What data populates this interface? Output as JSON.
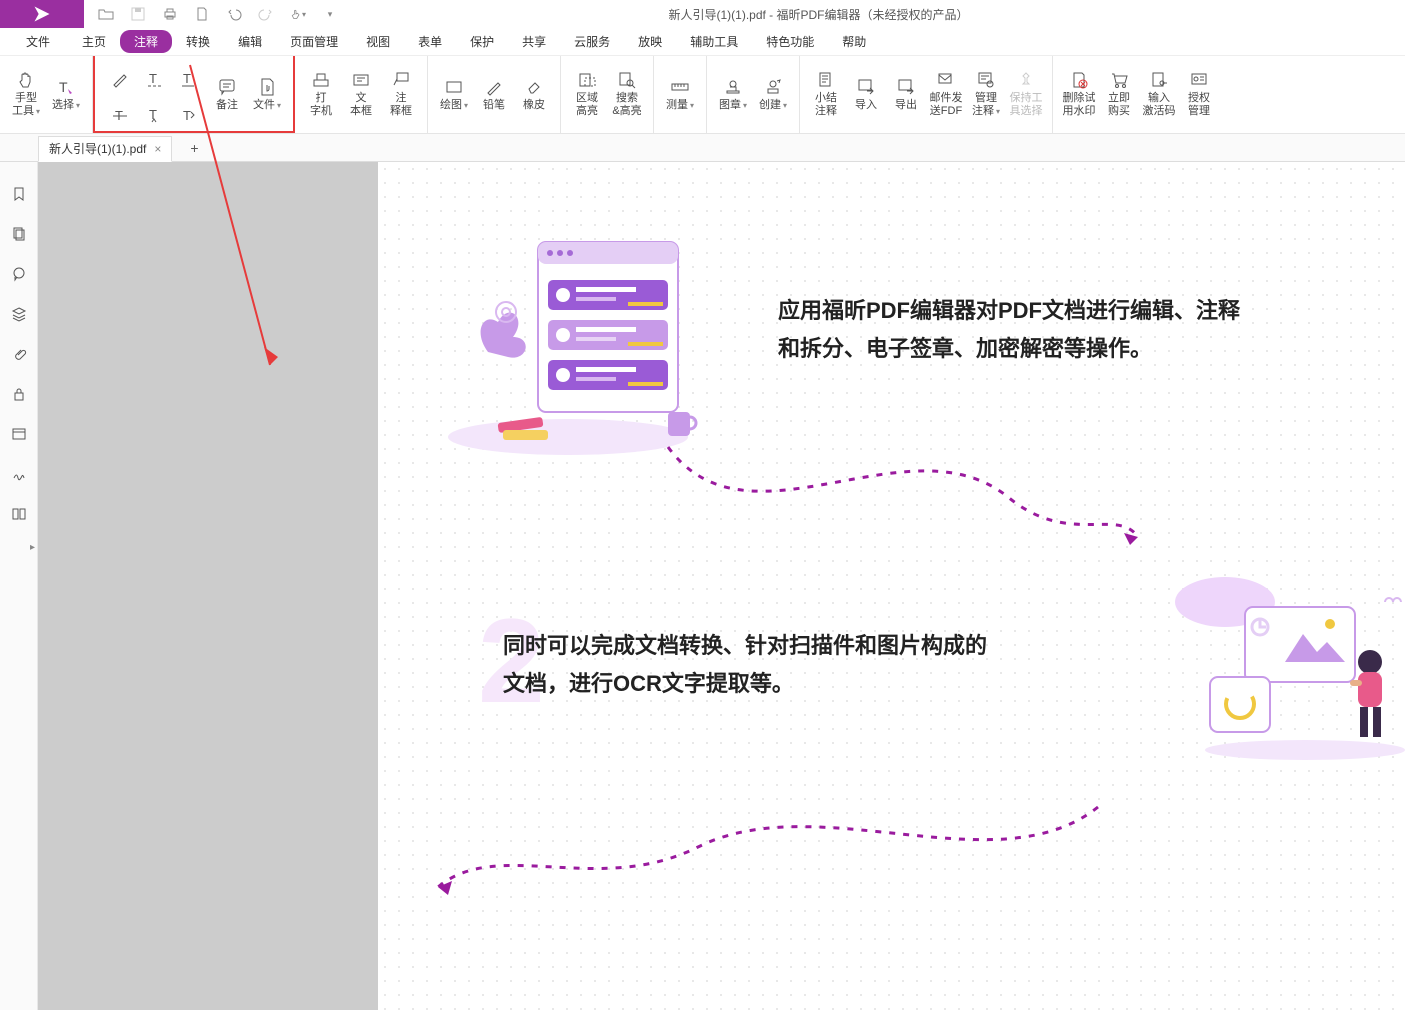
{
  "app_title": "新人引导(1)(1).pdf - 福昕PDF编辑器（未经授权的产品）",
  "menu": {
    "file": "文件",
    "items": [
      "主页",
      "注释",
      "转换",
      "编辑",
      "页面管理",
      "视图",
      "表单",
      "保护",
      "共享",
      "云服务",
      "放映",
      "辅助工具",
      "特色功能",
      "帮助"
    ],
    "active_index": 1
  },
  "ribbon": {
    "hand": "手型\n工具",
    "select": "选择",
    "note": "备注",
    "file_attach": "文件",
    "typewriter": "打\n字机",
    "textbox": "文\n本框",
    "callout": "注\n释框",
    "draw": "绘图",
    "pencil": "铅笔",
    "eraser": "橡皮",
    "area_highlight": "区域\n高亮",
    "search_highlight": "搜索\n&高亮",
    "measure": "测量",
    "stamp": "图章",
    "create": "创建",
    "summary": "小结\n注释",
    "import": "导入",
    "export": "导出",
    "email": "邮件发\n送FDF",
    "manage": "管理\n注释",
    "keep": "保持工\n具选择",
    "del_trial": "删除试\n用水印",
    "buy": "立即\n购买",
    "activate": "输入\n激活码",
    "license": "授权\n管理"
  },
  "tab": {
    "name": "新人引导(1)(1).pdf"
  },
  "content": {
    "line1a": "应用福昕PDF编辑器对PDF文档进行编辑、注释",
    "line1b": "和拆分、电子签章、加密解密等操作。",
    "line2a": "同时可以完成文档转换、针对扫描件和图片构成的",
    "line2b": "文档，进行OCR文字提取等。"
  }
}
